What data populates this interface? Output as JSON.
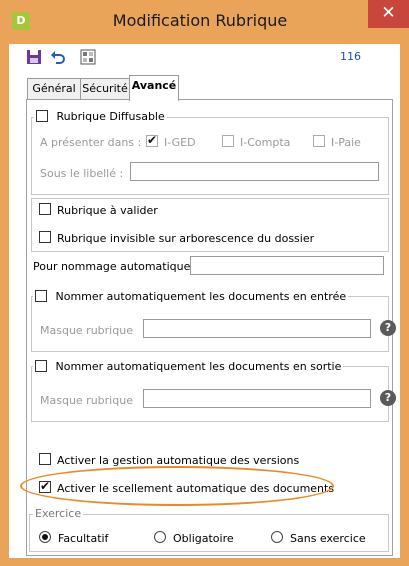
{
  "window": {
    "app_icon": "D",
    "title": "Modification Rubrique",
    "close_label": "✕"
  },
  "toolbar": {
    "icons": [
      "save-icon",
      "undo-icon",
      "properties-icon"
    ],
    "record_number": "116"
  },
  "tabs": [
    {
      "label": "Général",
      "active": false
    },
    {
      "label": "Sécurité",
      "active": false
    },
    {
      "label": "Avancé",
      "active": true
    }
  ],
  "diffusable": {
    "label": "Rubrique Diffusable",
    "checked": false,
    "present_label": "A présenter dans :",
    "options": [
      {
        "label": "I-GED",
        "checked": true
      },
      {
        "label": "I-Compta",
        "checked": false
      },
      {
        "label": "I-Paie",
        "checked": false
      }
    ],
    "sublabel_label": "Sous le libellé :",
    "sublabel_value": ""
  },
  "checks": {
    "a_valider": "Rubrique à valider",
    "invisible": "Rubrique invisible sur arborescence du dossier"
  },
  "nommage": {
    "label": "Pour nommage automatique",
    "value": ""
  },
  "entree": {
    "label": "Nommer automatiquement les documents en entrée",
    "mask_label": "Masque rubrique",
    "mask_value": "",
    "help": "?"
  },
  "sortie": {
    "label": "Nommer automatiquement les documents en sortie",
    "mask_label": "Masque rubrique",
    "mask_value": "",
    "help": "?"
  },
  "versions": {
    "label": "Activer la gestion automatique des versions",
    "checked": false
  },
  "scellement": {
    "label": "Activer le scellement automatique des documents",
    "checked": true
  },
  "exercice": {
    "legend": "Exercice",
    "options": [
      {
        "label": "Facultatif",
        "selected": true
      },
      {
        "label": "Obligatoire",
        "selected": false
      },
      {
        "label": "Sans exercice",
        "selected": false
      }
    ]
  },
  "colors": {
    "frame": "#eaa45a",
    "close": "#c9463d",
    "highlight": "#e88a2a",
    "accent_blue": "#1f4fa8"
  }
}
